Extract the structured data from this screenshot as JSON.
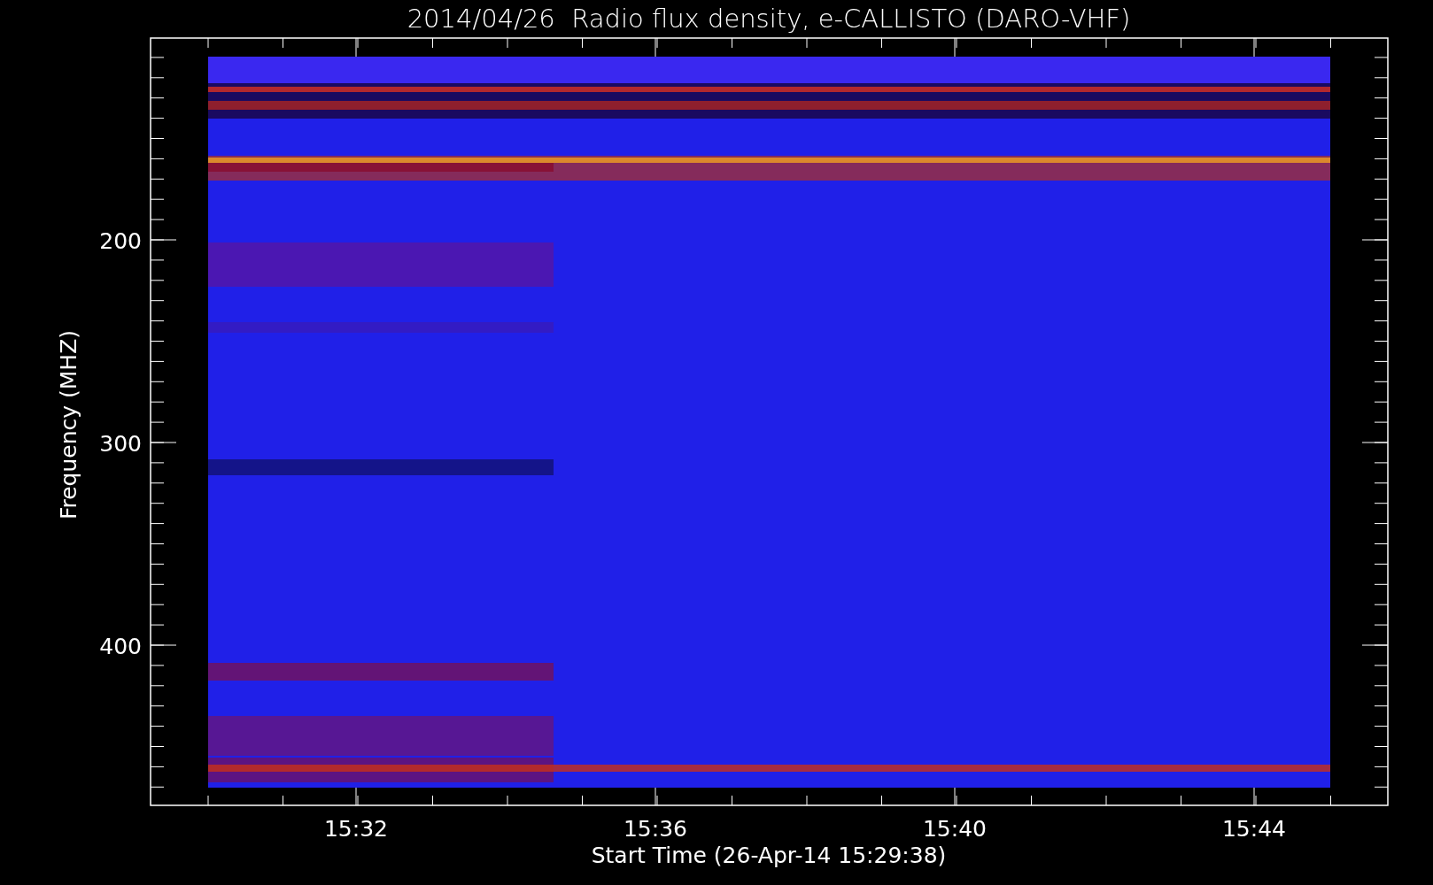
{
  "plot": {
    "title": "2014/04/26  Radio flux density, e-CALLISTO (DARO-VHF)",
    "xlabel": "Start Time (26-Apr-14 15:29:38)",
    "ylabel": "Frequency (MHZ)",
    "xtick_labels": [
      "15:32",
      "15:36",
      "15:40",
      "15:44"
    ],
    "ytick_labels": [
      "200",
      "300",
      "400"
    ],
    "spectrogram": {
      "kind": "picture"
    }
  }
}
